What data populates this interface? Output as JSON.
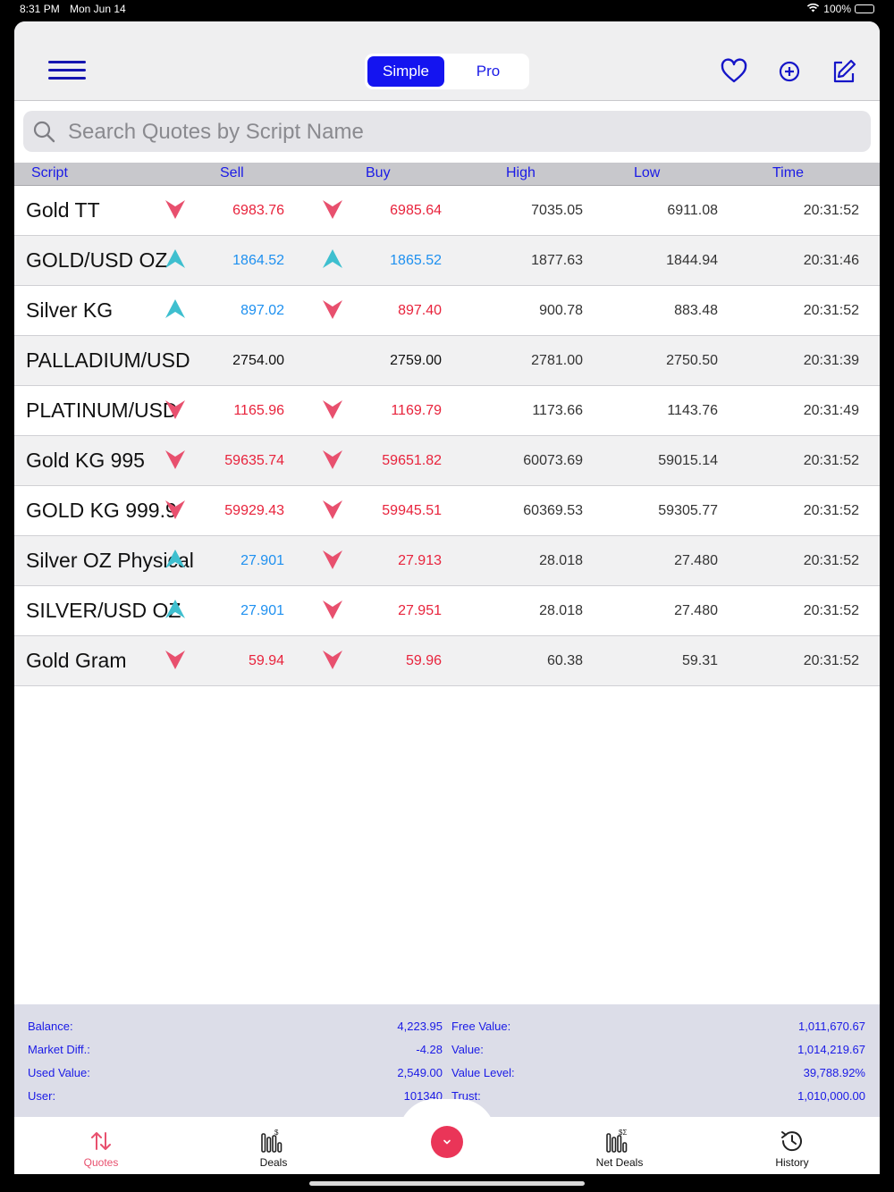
{
  "status_bar": {
    "time": "8:31 PM",
    "date": "Mon Jun 14",
    "battery": "100%"
  },
  "header": {
    "segments": [
      "Simple",
      "Pro"
    ],
    "active_segment": "Simple"
  },
  "search": {
    "placeholder": "Search Quotes by Script Name",
    "value": ""
  },
  "columns": [
    "Script",
    "Sell",
    "Buy",
    "High",
    "Low",
    "Time"
  ],
  "colors": {
    "down": "#e8233c",
    "up": "#1e90f0",
    "neutral": "#111111",
    "arrow_down": "#e8506e",
    "arrow_up": "#3ebfcf",
    "accent": "#1414f0"
  },
  "quotes": [
    {
      "name": "Gold TT",
      "sell": "6983.76",
      "sell_dir": "down",
      "buy": "6985.64",
      "buy_dir": "down",
      "high": "7035.05",
      "low": "6911.08",
      "time": "20:31:52"
    },
    {
      "name": "GOLD/USD OZ",
      "sell": "1864.52",
      "sell_dir": "up",
      "buy": "1865.52",
      "buy_dir": "up",
      "high": "1877.63",
      "low": "1844.94",
      "time": "20:31:46"
    },
    {
      "name": "Silver KG",
      "sell": "897.02",
      "sell_dir": "up",
      "buy": "897.40",
      "buy_dir": "down",
      "high": "900.78",
      "low": "883.48",
      "time": "20:31:52"
    },
    {
      "name": "PALLADIUM/USD",
      "sell": "2754.00",
      "sell_dir": "none",
      "buy": "2759.00",
      "buy_dir": "none",
      "high": "2781.00",
      "low": "2750.50",
      "time": "20:31:39"
    },
    {
      "name": "PLATINUM/USD",
      "sell": "1165.96",
      "sell_dir": "down",
      "buy": "1169.79",
      "buy_dir": "down",
      "high": "1173.66",
      "low": "1143.76",
      "time": "20:31:49"
    },
    {
      "name": "Gold KG 995",
      "sell": "59635.74",
      "sell_dir": "down",
      "buy": "59651.82",
      "buy_dir": "down",
      "high": "60073.69",
      "low": "59015.14",
      "time": "20:31:52"
    },
    {
      "name": "GOLD KG 999.9",
      "sell": "59929.43",
      "sell_dir": "down",
      "buy": "59945.51",
      "buy_dir": "down",
      "high": "60369.53",
      "low": "59305.77",
      "time": "20:31:52"
    },
    {
      "name": "Silver OZ Physical",
      "sell": "27.901",
      "sell_dir": "up",
      "buy": "27.913",
      "buy_dir": "down",
      "high": "28.018",
      "low": "27.480",
      "time": "20:31:52"
    },
    {
      "name": "SILVER/USD OZ",
      "sell": "27.901",
      "sell_dir": "up",
      "buy": "27.951",
      "buy_dir": "down",
      "high": "28.018",
      "low": "27.480",
      "time": "20:31:52"
    },
    {
      "name": "Gold Gram",
      "sell": "59.94",
      "sell_dir": "down",
      "buy": "59.96",
      "buy_dir": "down",
      "high": "60.38",
      "low": "59.31",
      "time": "20:31:52"
    }
  ],
  "account": {
    "balance_label": "Balance:",
    "balance": "4,223.95",
    "market_diff_label": "Market Diff.:",
    "market_diff": "-4.28",
    "used_value_label": "Used Value:",
    "used_value": "2,549.00",
    "user_label": "User:",
    "user": "101340",
    "free_value_label": "Free Value:",
    "free_value": "1,011,670.67",
    "value_label": "Value:",
    "value": "1,014,219.67",
    "value_level_label": "Value Level:",
    "value_level": "39,788.92%",
    "trust_label": "Trust:",
    "trust": "1,010,000.00"
  },
  "tabs": {
    "quotes": "Quotes",
    "deals": "Deals",
    "net_deals": "Net Deals",
    "history": "History"
  }
}
